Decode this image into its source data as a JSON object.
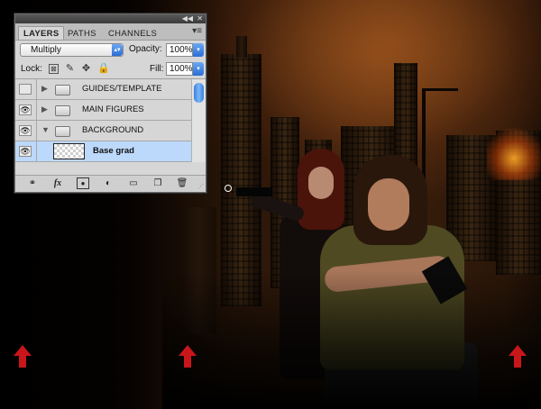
{
  "panel": {
    "tabs": [
      "LAYERS",
      "PATHS",
      "CHANNELS"
    ],
    "active_tab": "LAYERS",
    "blend_mode": "Multiply",
    "opacity_label": "Opacity:",
    "opacity_value": "100%",
    "lock_label": "Lock:",
    "fill_label": "Fill:",
    "fill_value": "100%",
    "layers": [
      {
        "name": "GUIDES/TEMPLATE",
        "type": "group",
        "visible": false,
        "expanded": false
      },
      {
        "name": "MAIN FIGURES",
        "type": "group",
        "visible": true,
        "expanded": false
      },
      {
        "name": "BACKGROUND",
        "type": "group",
        "visible": true,
        "expanded": true
      },
      {
        "name": "Base grad",
        "type": "layer",
        "visible": true,
        "selected": true
      }
    ],
    "footer_icons": [
      "link-icon",
      "fx-icon",
      "mask-icon",
      "adjustment-icon",
      "new-group-icon",
      "new-layer-icon",
      "trash-icon"
    ]
  },
  "canvas": {
    "guide_arrow_color": "#c8161b",
    "guide_arrow_count": 3
  },
  "colors": {
    "selection": "#bcd8fb",
    "accent_blue": "#2a6dd6"
  }
}
